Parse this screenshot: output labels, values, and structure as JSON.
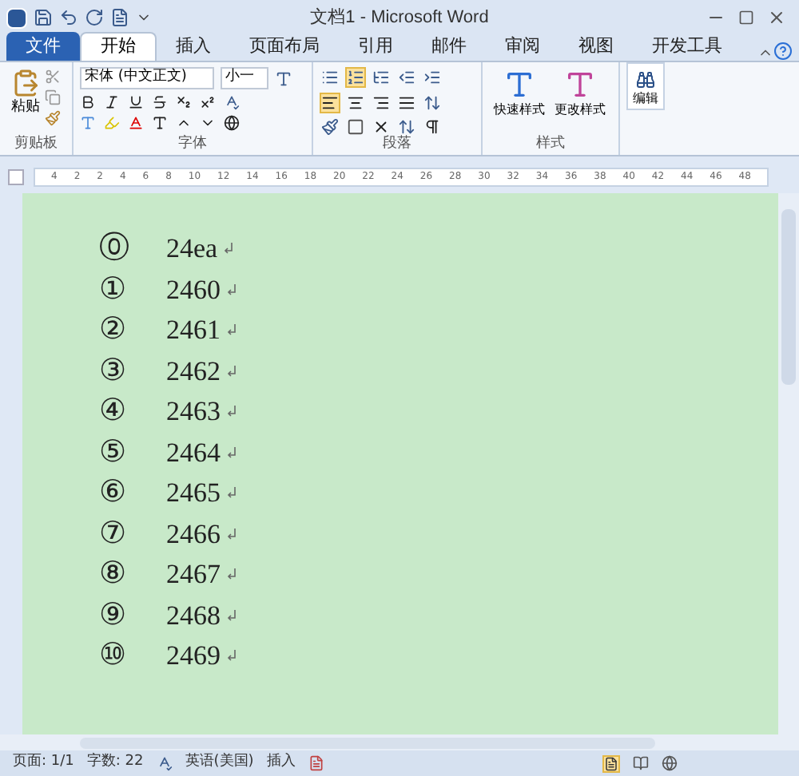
{
  "window": {
    "title": "文档1 - Microsoft Word"
  },
  "tabs": [
    {
      "label": "文件",
      "kind": "file",
      "selected": false
    },
    {
      "label": "开始",
      "kind": "tab",
      "selected": true
    },
    {
      "label": "插入",
      "kind": "tab",
      "selected": false
    },
    {
      "label": "页面布局",
      "kind": "tab",
      "selected": false
    },
    {
      "label": "引用",
      "kind": "tab",
      "selected": false
    },
    {
      "label": "邮件",
      "kind": "tab",
      "selected": false
    },
    {
      "label": "审阅",
      "kind": "tab",
      "selected": false
    },
    {
      "label": "视图",
      "kind": "tab",
      "selected": false
    },
    {
      "label": "开发工具",
      "kind": "tab",
      "selected": false
    }
  ],
  "ribbon": {
    "clipboard": {
      "label": "剪贴板",
      "paste": "粘贴"
    },
    "font": {
      "label": "字体",
      "font_name": "宋体 (中文正文)",
      "font_size": "小一"
    },
    "paragraph": {
      "label": "段落"
    },
    "styles": {
      "label": "样式",
      "quick_styles": "快速样式",
      "change_styles": "更改样式"
    },
    "editing": {
      "label": "编辑"
    }
  },
  "ruler": [
    "4",
    "2",
    "2",
    "4",
    "6",
    "8",
    "10",
    "12",
    "14",
    "16",
    "18",
    "20",
    "22",
    "24",
    "26",
    "28",
    "30",
    "32",
    "34",
    "36",
    "38",
    "40",
    "42",
    "44",
    "46",
    "48"
  ],
  "document": {
    "items": [
      {
        "marker": "⓪",
        "text": "24ea"
      },
      {
        "marker": "①",
        "text": "2460"
      },
      {
        "marker": "②",
        "text": "2461"
      },
      {
        "marker": "③",
        "text": "2462"
      },
      {
        "marker": "④",
        "text": "2463"
      },
      {
        "marker": "⑤",
        "text": "2464"
      },
      {
        "marker": "⑥",
        "text": "2465"
      },
      {
        "marker": "⑦",
        "text": "2466"
      },
      {
        "marker": "⑧",
        "text": "2467"
      },
      {
        "marker": "⑨",
        "text": "2468"
      },
      {
        "marker": "⑩",
        "text": "2469"
      }
    ]
  },
  "status_bar": {
    "page": "页面: 1/1",
    "words": "字数: 22",
    "language": "英语(美国)",
    "mode": "插入"
  }
}
